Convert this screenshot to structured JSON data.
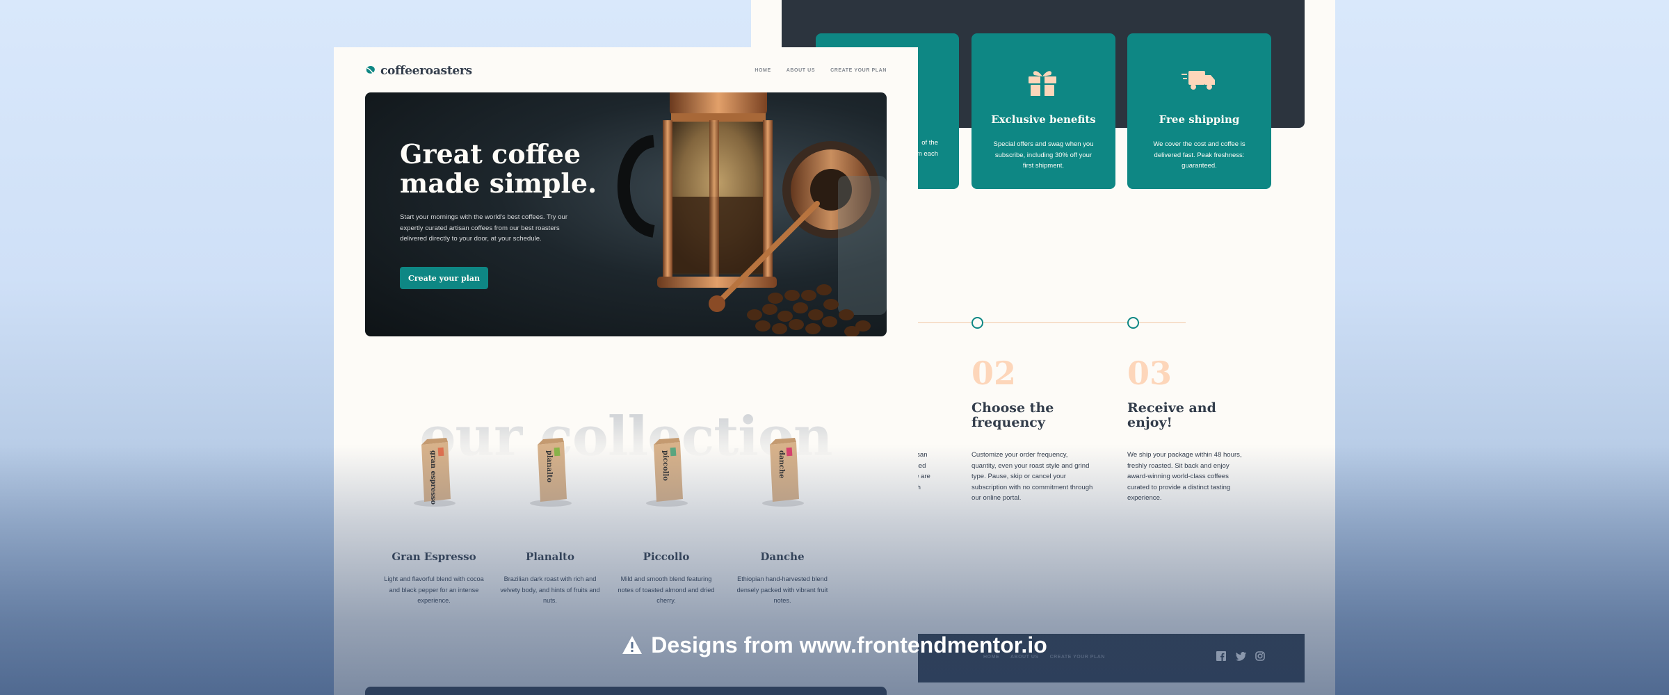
{
  "brand": {
    "name": "coffeeroasters"
  },
  "nav": {
    "home": "HOME",
    "about": "ABOUT US",
    "plan": "CREATE YOUR PLAN"
  },
  "hero": {
    "title": "Great coffee made simple.",
    "description": "Start your mornings with the world's best coffees. Try our expertly curated artisan coffees from our best roasters delivered directly to your door, at your schedule.",
    "cta": "Create your plan"
  },
  "collection": {
    "heading": "our collection",
    "items": [
      {
        "name": "Gran Espresso",
        "desc": "Light and flavorful blend with cocoa and black pepper for an intense experience.",
        "bag_label": "gran espresso",
        "tab_color": "#e0704f"
      },
      {
        "name": "Planalto",
        "desc": "Brazilian dark roast with rich and velvety body, and hints of fruits and nuts.",
        "bag_label": "planalto",
        "tab_color": "#8ab548"
      },
      {
        "name": "Piccollo",
        "desc": "Mild and smooth blend featuring notes of toasted almond and dried cherry.",
        "bag_label": "piccollo",
        "tab_color": "#5aa77f"
      },
      {
        "name": "Danche",
        "desc": "Ethiopian hand-harvested blend densely packed with vibrant fruit notes.",
        "bag_label": "danche",
        "tab_color": "#d9406e"
      }
    ]
  },
  "benefits": {
    "partial_card_text": "of the\nm each",
    "cards": [
      {
        "title": "Exclusive benefits",
        "desc": "Special offers and swag when you subscribe, including 30% off your first shipment.",
        "icon": "gift-icon"
      },
      {
        "title": "Free shipping",
        "desc": "We cover the cost and coffee is delivered fast. Peak freshness: guaranteed.",
        "icon": "truck-icon"
      }
    ]
  },
  "steps": {
    "partial_text": "isan\nced\ne are\nth",
    "items": [
      {
        "num": "02",
        "title": "Choose the frequency",
        "desc": "Customize your order frequency, quantity, even your roast style and grind type. Pause, skip or cancel your subscription with no commitment through our online portal."
      },
      {
        "num": "03",
        "title": "Receive and enjoy!",
        "desc": "We ship your package within 48 hours, freshly roasted. Sit back and enjoy award-winning world-class coffees curated to provide a distinct tasting experience."
      }
    ]
  },
  "footer": {
    "home": "HOME",
    "about": "ABOUT US",
    "plan": "CREATE YOUR PLAN",
    "social": [
      "facebook-icon",
      "twitter-icon",
      "instagram-icon"
    ]
  },
  "banner": {
    "text": "Designs from www.frontendmentor.io"
  },
  "colors": {
    "teal": "#0e8784",
    "dark_slate": "#2c343e",
    "cream": "#fdfbf7",
    "peach": "#fdd6ba"
  }
}
